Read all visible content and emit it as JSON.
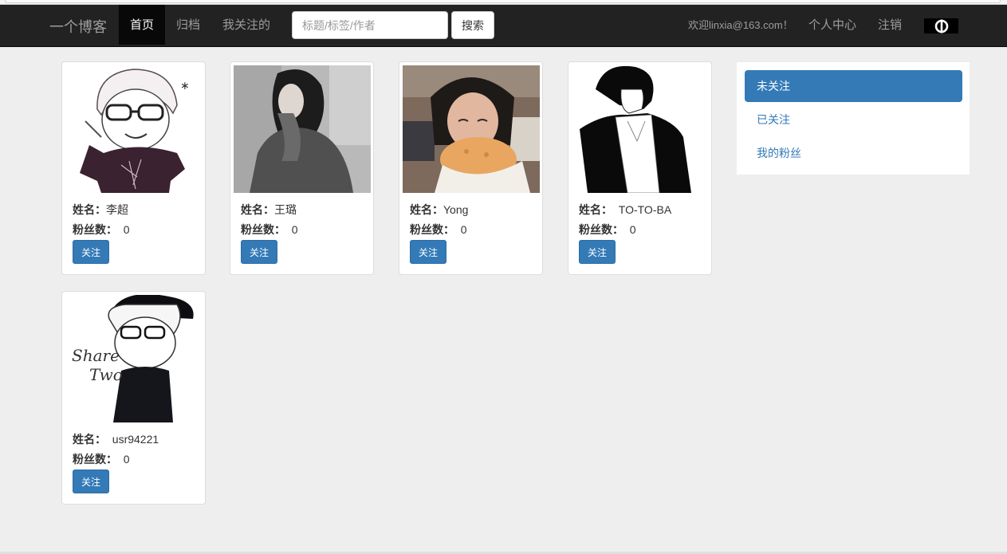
{
  "nav": {
    "brand": "一个博客",
    "links": [
      {
        "label": "首页",
        "active": true
      },
      {
        "label": "归档",
        "active": false
      },
      {
        "label": "我关注的",
        "active": false
      }
    ],
    "search_placeholder": "标题/标签/作者",
    "search_button": "搜索",
    "welcome": "欢迎linxia@163.com！",
    "personal_center": "个人中心",
    "logout": "注销",
    "theme_icon": "power-toggle-icon"
  },
  "labels": {
    "name": "姓名：",
    "followers": "粉丝数："
  },
  "users": [
    {
      "name": "李超",
      "followers": "0",
      "follow": "关注",
      "avatar": "sketch-boy-glasses-avatar"
    },
    {
      "name": "王璐",
      "followers": "0",
      "follow": "关注",
      "avatar": "girl-photo-avatar"
    },
    {
      "name": "Yong",
      "followers": "0",
      "follow": "关注",
      "avatar": "girl-eating-avatar"
    },
    {
      "name": "TO-TO-BA",
      "followers": "0",
      "follow": "关注",
      "avatar": "anime-boy-avatar"
    },
    {
      "name": "usr94221",
      "followers": "0",
      "follow": "关注",
      "avatar": "share-two-cartoon-avatar"
    }
  ],
  "sidebar": {
    "items": [
      {
        "label": "未关注",
        "active": true
      },
      {
        "label": "已关注",
        "active": false
      },
      {
        "label": "我的粉丝",
        "active": false
      }
    ]
  },
  "colors": {
    "navbar": "#222222",
    "primary": "#337ab7",
    "page_bg": "#eeeeee"
  }
}
